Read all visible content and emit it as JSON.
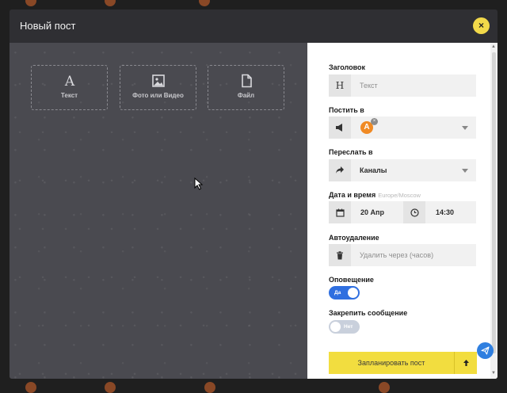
{
  "modal": {
    "title": "Новый пост",
    "close_glyph": "×"
  },
  "post_types": [
    {
      "label": "Текст",
      "icon": "letter-a-icon"
    },
    {
      "label": "Фото или Видео",
      "icon": "image-icon"
    },
    {
      "label": "Файл",
      "icon": "file-icon"
    }
  ],
  "form": {
    "title": {
      "label": "Заголовок",
      "placeholder": "Текст",
      "icon_glyph": "H"
    },
    "post_to": {
      "label": "Постить в",
      "avatar_letter": "A",
      "remove_glyph": "×"
    },
    "forward_to": {
      "label": "Переслать в",
      "value": "Каналы"
    },
    "datetime": {
      "label": "Дата и время",
      "timezone": "Europe/Moscow",
      "date": "20 Апр",
      "time": "14:30"
    },
    "autodelete": {
      "label": "Автоудаление",
      "placeholder": "Удалить через (часов)"
    },
    "notification": {
      "label": "Оповещение",
      "state": "Да",
      "on": true
    },
    "pin": {
      "label": "Закрепить сообщение",
      "state": "Нет",
      "on": false
    },
    "schedule_button": "Запланировать пост"
  },
  "colors": {
    "accent_yellow": "#f2dd3f",
    "toggle_blue": "#2f6fe0",
    "close_yellow": "#f2d94a"
  }
}
